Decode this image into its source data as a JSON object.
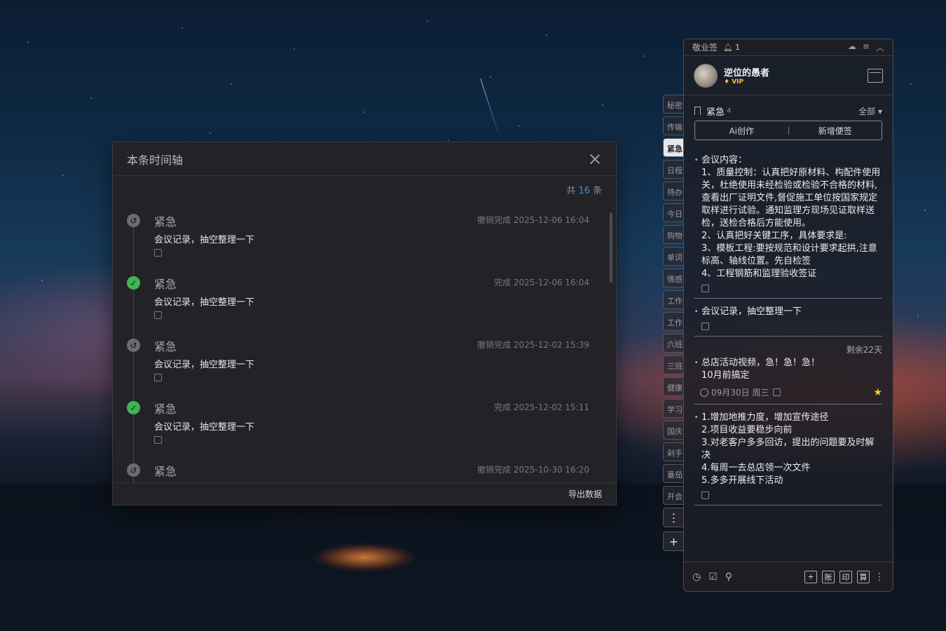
{
  "dialog": {
    "title": "本条时间轴",
    "count_prefix": "共",
    "count_value": "16",
    "count_suffix": "条",
    "export_label": "导出数据",
    "entries": [
      {
        "status": "undo",
        "title": "紧急",
        "time": "撤销完成 2025-12-06 16:04",
        "content": "会议记录，抽空整理一下"
      },
      {
        "status": "done",
        "title": "紧急",
        "time": "完成 2025-12-06 16:04",
        "content": "会议记录，抽空整理一下"
      },
      {
        "status": "undo",
        "title": "紧急",
        "time": "撤销完成 2025-12-02 15:39",
        "content": "会议记录，抽空整理一下"
      },
      {
        "status": "done",
        "title": "紧急",
        "time": "完成 2025-12-02 15:11",
        "content": "会议记录，抽空整理一下"
      },
      {
        "status": "undo",
        "title": "紧急",
        "time": "撤销完成 2025-10-30 16:20",
        "content": ""
      }
    ]
  },
  "side_tabs": {
    "items": [
      "秘密",
      "传输",
      "紧急",
      "日程",
      "待办",
      "今日",
      "购物",
      "单词",
      "情感",
      "工作",
      "工作",
      "六班",
      "三班",
      "健康",
      "学习",
      "国庆",
      "剁手",
      "番茄",
      "开会"
    ],
    "active_index": 2,
    "more_label": "⋮",
    "add_label": "+"
  },
  "panel": {
    "app_name": "敬业签",
    "bell_count": "1",
    "username": "逆位的愚者",
    "vip_label": "VIP",
    "category": "紧急",
    "category_count": "4",
    "filter_label": "全部 ▾",
    "ai_label": "Ai创作",
    "new_label": "新增便签",
    "notes": [
      {
        "text": "会议内容：\n1、质量控制：认真把好原材料、构配件使用关，杜绝使用未经检验或检验不合格的材料,查看出厂证明文件,督促施工单位按国家规定取样进行试验。通知监理方现场见证取样送检，送检合格后方能使用。\n2、认真把好关键工序，具体要求是:\n3、模板工程:要按规范和设计要求起拱,注意标高、轴线位置。先自检签\n4、工程钢筋和监理验收签证"
      },
      {
        "text": "会议记录，抽空整理一下"
      },
      {
        "remain": "剩余22天",
        "text": "总店活动视频，急！急！急！\n10月前搞定",
        "date": "09月30日 周三"
      },
      {
        "text": "1.增加地推力度，增加宣传途径\n2.项目收益要稳步向前\n3.对老客户多多回访，提出的问题要及时解决\n4.每周一去总店领一次文件\n5.多多开展线下活动"
      }
    ],
    "bottom_buttons": [
      "+",
      "账",
      "印",
      "算"
    ]
  },
  "colors": {
    "accent_blue": "#3d8ef0",
    "done_green": "#3fb552",
    "vip_gold": "#f2c230",
    "star_yellow": "#f5cf2a"
  }
}
